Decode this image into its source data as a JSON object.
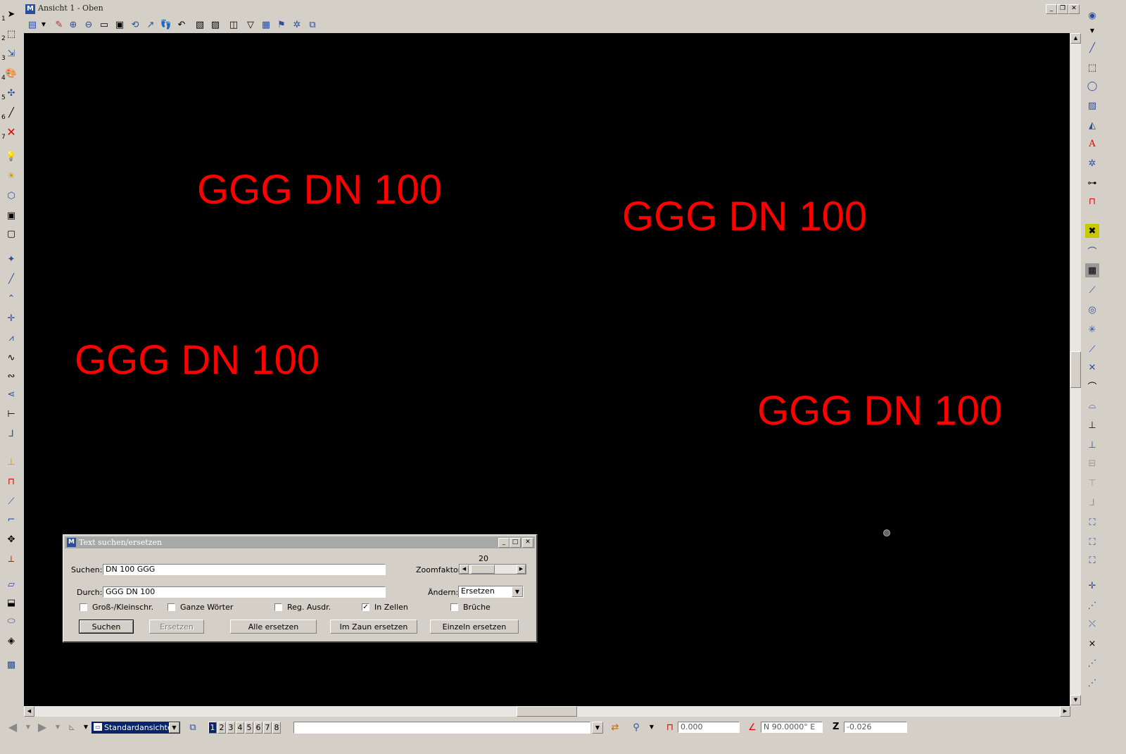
{
  "window": {
    "title": "Ansicht 1 - Oben",
    "minimize": "_",
    "restore": "❐",
    "close": "✕"
  },
  "canvas_texts": [
    "GGG DN 100",
    "GGG DN 100",
    "GGG DN 100",
    "GGG DN 100"
  ],
  "left_tool_numbers": [
    "1",
    "2",
    "3",
    "4",
    "5",
    "6",
    "7"
  ],
  "dialog": {
    "title": "Text suchen/ersetzen",
    "suchen_label": "Suchen:",
    "suchen_value": "DN 100 GGG",
    "durch_label": "Durch:",
    "durch_value": "GGG DN 100",
    "zoomfaktor_label": "Zoomfaktor",
    "zoomfaktor_value": "20",
    "aendern_label": "Ändern:",
    "aendern_value": "Ersetzen",
    "checkboxes": [
      {
        "label": "Groß-/Kleinschr.",
        "checked": false
      },
      {
        "label": "Ganze Wörter",
        "checked": false
      },
      {
        "label": "Reg. Ausdr.",
        "checked": false
      },
      {
        "label": "In Zellen",
        "checked": true
      },
      {
        "label": "Brüche",
        "checked": false
      }
    ],
    "buttons": {
      "suchen": "Suchen",
      "ersetzen": "Ersetzen",
      "alle": "Alle ersetzen",
      "zaun": "Im Zaun ersetzen",
      "einzeln": "Einzeln ersetzen"
    }
  },
  "statusbar": {
    "view_dropdown": "Standardansichten",
    "view_numbers": [
      "1",
      "2",
      "3",
      "4",
      "5",
      "6",
      "7",
      "8"
    ],
    "distance_value": "0.000",
    "angle_value": "N 90.0000° E",
    "z_label": "Z",
    "z_value": "-0.026"
  },
  "colors": {
    "canvas_bg": "#000000",
    "cad_text": "#ff0000",
    "chrome": "#d4d0c8",
    "inactive_title": "#a8a8a8"
  }
}
